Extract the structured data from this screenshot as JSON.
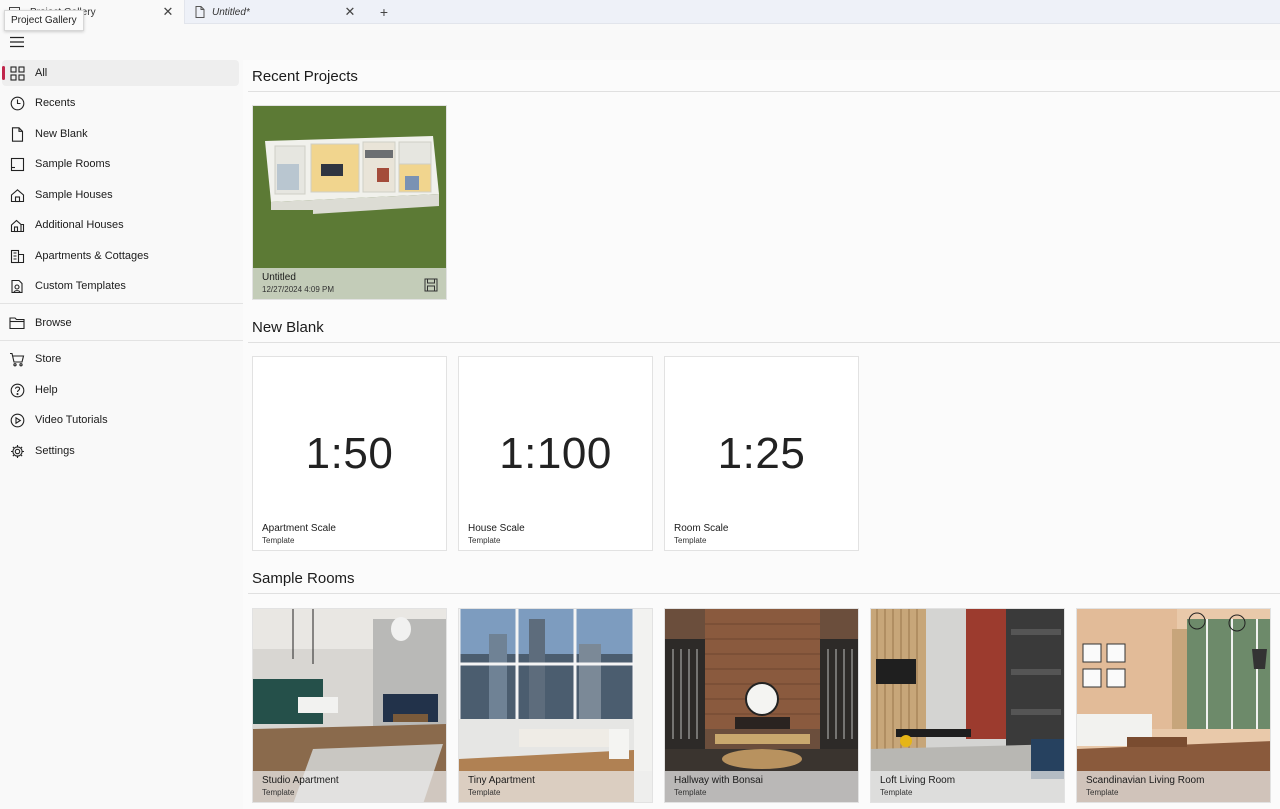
{
  "tabs": {
    "active_label": "Project Gallery",
    "second_label": "Untitled*",
    "add_label": "+",
    "close_glyph": "✕"
  },
  "tooltip": "Project Gallery",
  "sidebar": {
    "items": [
      {
        "label": "All",
        "icon": "grid-icon"
      },
      {
        "label": "Recents",
        "icon": "clock-icon"
      },
      {
        "label": "New Blank",
        "icon": "document-icon"
      },
      {
        "label": "Sample Rooms",
        "icon": "room-icon"
      },
      {
        "label": "Sample Houses",
        "icon": "house-icon"
      },
      {
        "label": "Additional Houses",
        "icon": "house-plus-icon"
      },
      {
        "label": "Apartments & Cottages",
        "icon": "apartment-icon"
      },
      {
        "label": "Custom Templates",
        "icon": "custom-template-icon"
      },
      {
        "label": "Browse",
        "icon": "folder-icon"
      },
      {
        "label": "Store",
        "icon": "cart-icon"
      },
      {
        "label": "Help",
        "icon": "help-icon"
      },
      {
        "label": "Video Tutorials",
        "icon": "play-icon"
      },
      {
        "label": "Settings",
        "icon": "gear-icon"
      }
    ]
  },
  "sections": {
    "recent": {
      "title": "Recent Projects",
      "items": [
        {
          "title": "Untitled",
          "subtitle": "12/27/2024 4:09 PM"
        }
      ]
    },
    "new_blank": {
      "title": "New Blank",
      "items": [
        {
          "scale": "1:50",
          "title": "Apartment Scale",
          "subtitle": "Template"
        },
        {
          "scale": "1:100",
          "title": "House Scale",
          "subtitle": "Template"
        },
        {
          "scale": "1:25",
          "title": "Room Scale",
          "subtitle": "Template"
        }
      ]
    },
    "sample_rooms": {
      "title": "Sample Rooms",
      "items": [
        {
          "title": "Studio Apartment",
          "subtitle": "Template"
        },
        {
          "title": "Tiny Apartment",
          "subtitle": "Template"
        },
        {
          "title": "Hallway with Bonsai",
          "subtitle": "Template"
        },
        {
          "title": "Loft Living Room",
          "subtitle": "Template"
        },
        {
          "title": "Scandinavian Living Room",
          "subtitle": "Template"
        }
      ]
    }
  },
  "colors": {
    "accent": "#c0264b",
    "recent_bg": "#5c7a35"
  }
}
